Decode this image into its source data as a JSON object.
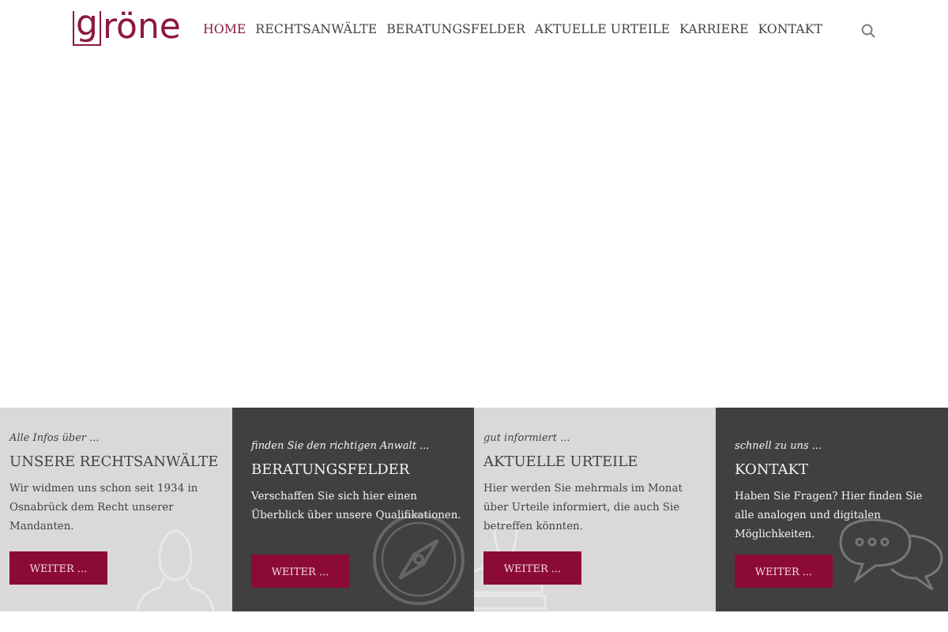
{
  "logo": "gröne",
  "nav": [
    {
      "label": "HOME",
      "selected": true
    },
    {
      "label": "RECHTSANWÄLTE",
      "selected": false
    },
    {
      "label": "BERATUNGSFELDER",
      "selected": false
    },
    {
      "label": "AKTUELLE URTEILE",
      "selected": false
    },
    {
      "label": "KARRIERE",
      "selected": false
    },
    {
      "label": "KONTAKT",
      "selected": false
    }
  ],
  "panels": [
    {
      "kind": "person",
      "dark": false,
      "tagline": "Alle Infos über ...",
      "title": "UNSERE RECHTSANWÄLTE",
      "text": "Wir widmen uns schon seit 1934 in Osnabrück dem Recht unserer Mandanten.",
      "button": "WEITER ..."
    },
    {
      "kind": "compass",
      "dark": true,
      "tagline": "finden Sie den richtigen Anwalt ...",
      "title": "BERATUNGSFELDER",
      "text": "Verschaffen Sie sich hier einen Überblick über unsere Qualifikationen.",
      "button": "WEITER ..."
    },
    {
      "kind": "stamp",
      "dark": false,
      "tagline": "gut informiert ...",
      "title": "AKTUELLE URTEILE",
      "text": "Hier werden Sie mehrmals im Monat über Urteile informiert, die auch Sie betreffen könnten.",
      "button": "WEITER ..."
    },
    {
      "kind": "chat",
      "dark": true,
      "tagline": "schnell zu uns ...",
      "title": "KONTAKT",
      "text": "Haben Sie Fragen? Hier finden Sie alle analogen und digitalen Möglichkeiten.",
      "button": "WEITER ..."
    }
  ]
}
